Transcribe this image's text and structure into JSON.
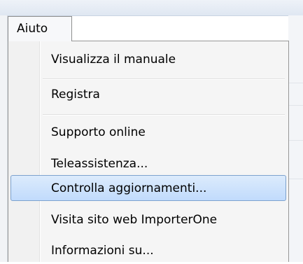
{
  "menubar": {
    "active_menu_label": "Aiuto"
  },
  "menu": {
    "items": [
      {
        "label": "Visualizza il manuale"
      },
      {
        "label": "Registra"
      },
      {
        "label": "Supporto online"
      },
      {
        "label": "Teleassistenza..."
      },
      {
        "label": "Controlla aggiornamenti..."
      },
      {
        "label": "Visita sito web ImporterOne"
      },
      {
        "label": "Informazioni su..."
      }
    ],
    "highlighted_item": "Controlla aggiornamenti...",
    "colors": {
      "highlight_fill": "#c9e0fc",
      "highlight_border": "#7da2ce",
      "menu_background": "#f5f5f5"
    }
  }
}
